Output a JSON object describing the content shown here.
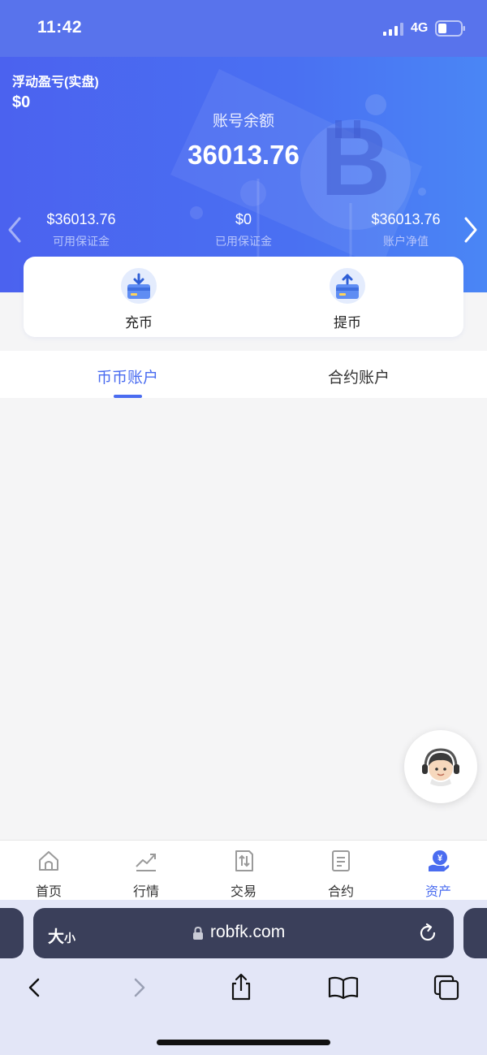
{
  "status_bar": {
    "time": "11:42",
    "network": "4G"
  },
  "header": {
    "floating_pnl_label": "浮动盈亏(实盘)",
    "floating_pnl_value": "$0",
    "balance_label": "账号余额",
    "balance_value": "36013.76"
  },
  "stats": [
    {
      "value": "$36013.76",
      "label": "可用保证金"
    },
    {
      "value": "$0",
      "label": "已用保证金"
    },
    {
      "value": "$36013.76",
      "label": "账户净值"
    }
  ],
  "actions": {
    "deposit_label": "充币",
    "withdraw_label": "提币"
  },
  "tabs": [
    {
      "label": "币币账户",
      "active": true
    },
    {
      "label": "合约账户",
      "active": false
    }
  ],
  "bottom_nav": [
    {
      "label": "首页",
      "icon": "home-icon"
    },
    {
      "label": "行情",
      "icon": "chart-icon"
    },
    {
      "label": "交易",
      "icon": "trade-icon"
    },
    {
      "label": "合约",
      "icon": "contract-icon"
    },
    {
      "label": "资产",
      "icon": "assets-icon",
      "active": true
    }
  ],
  "browser": {
    "text_size_label": "大",
    "text_size_small": "小",
    "url": "robfk.com"
  },
  "colors": {
    "accent": "#4a6cf0",
    "hero_start": "#4b62ef",
    "hero_end": "#4a86f5"
  }
}
